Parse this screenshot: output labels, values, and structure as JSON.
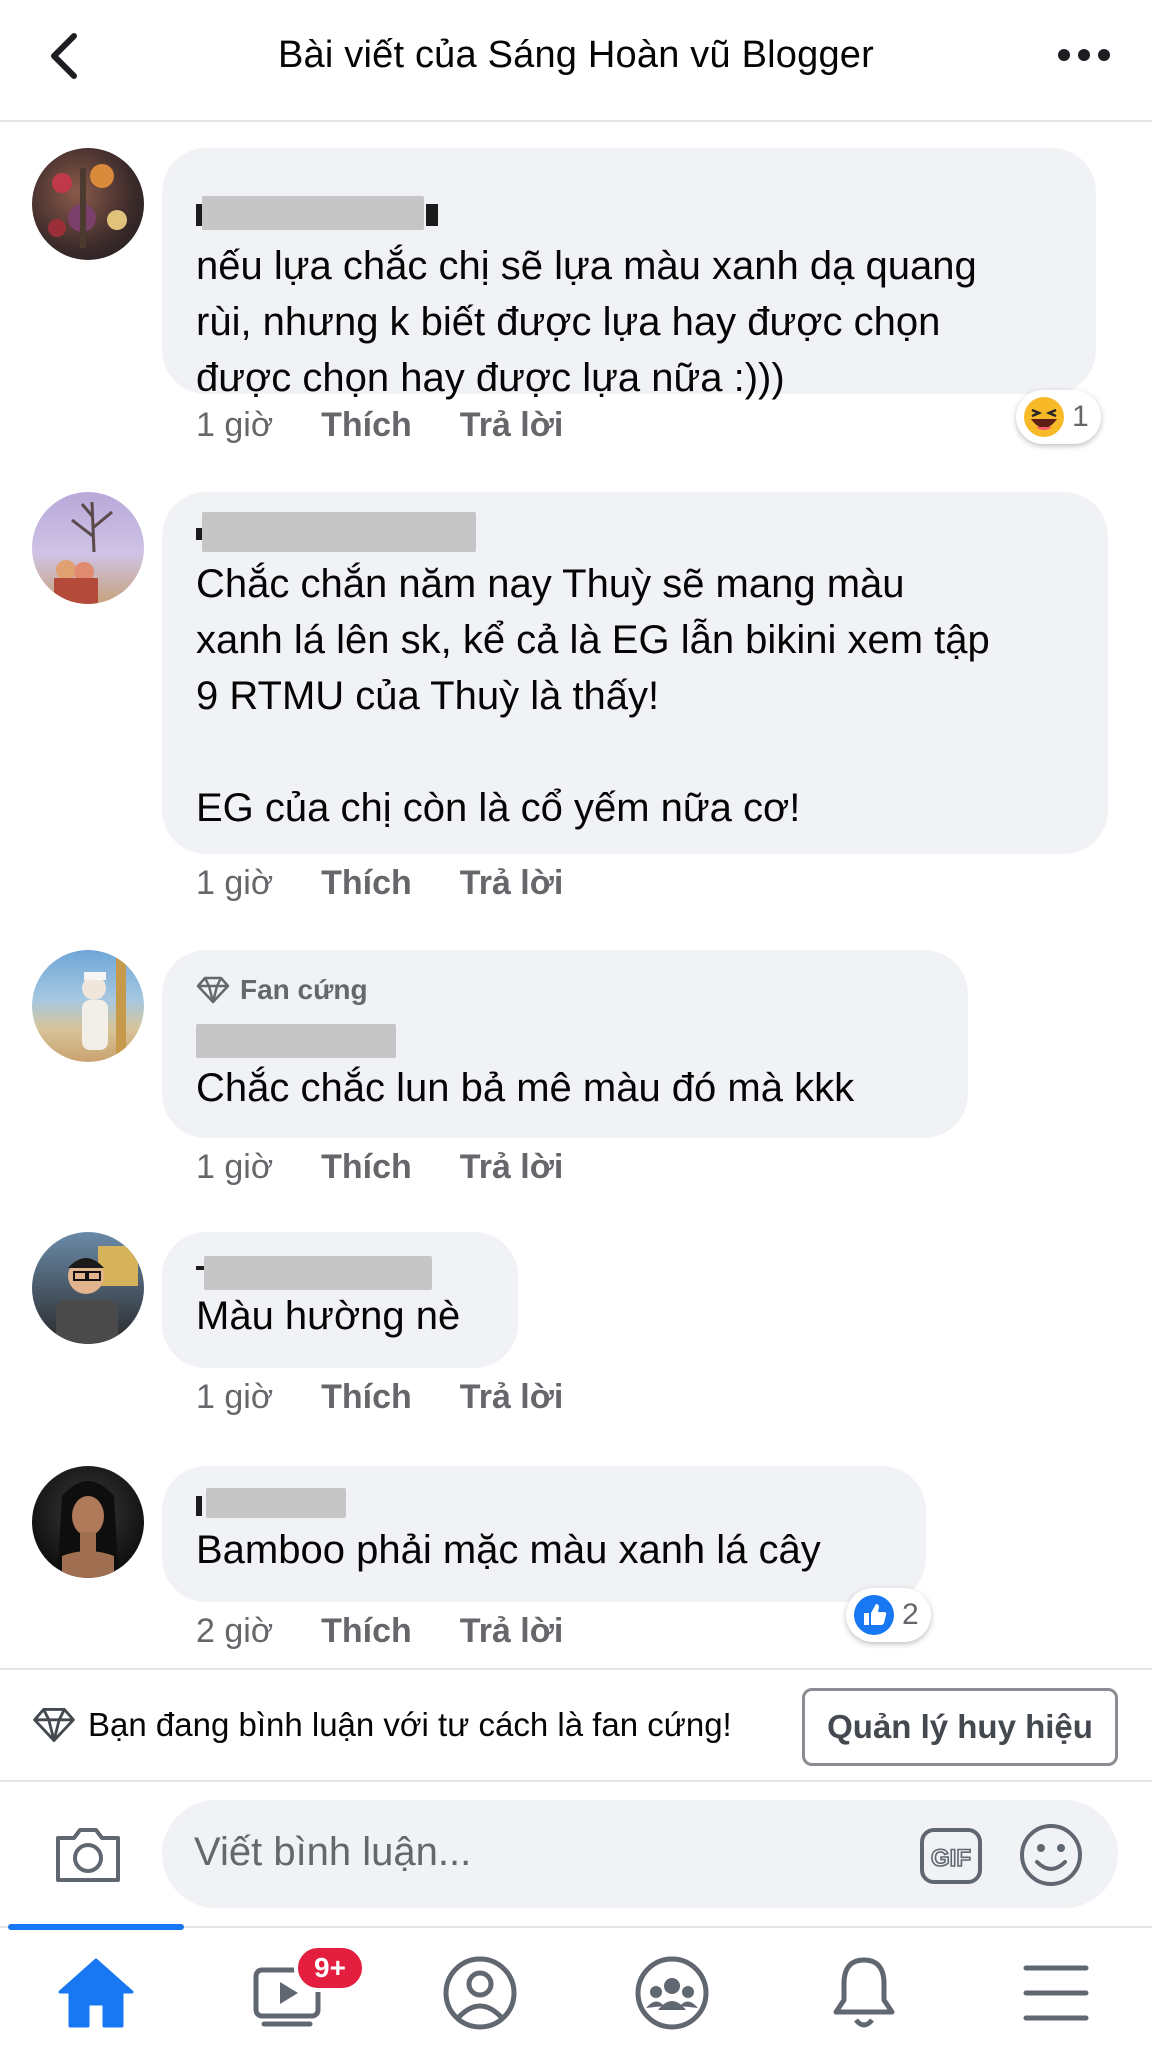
{
  "header": {
    "title": "Bài viết của Sáng Hoàn vũ Blogger",
    "back_icon": "chevron-left-icon",
    "more_icon": "more-horizontal-icon"
  },
  "comments": [
    {
      "badge": "",
      "text": "nếu lựa chắc chị sẽ lựa màu xanh dạ quang\nrùi, nhưng k biết được lựa hay được chọn\nđược chọn hay được lựa nữa :)))",
      "time": "1 giờ",
      "like": "Thích",
      "reply": "Trả lời",
      "reaction": {
        "icon": "haha-emoji-icon",
        "count": "1"
      }
    },
    {
      "badge": "",
      "text": "Chắc chắn năm nay Thuỳ sẽ mang màu\nxanh lá lên sk, kể cả là EG lẫn bikini xem tập\n9 RTMU của Thuỳ là thấy!\n\nEG của chị còn là cổ yếm nữa cơ!",
      "time": "1 giờ",
      "like": "Thích",
      "reply": "Trả lời"
    },
    {
      "badge": "Fan cứng",
      "text": "Chắc chắc lun bả mê màu đó mà kkk",
      "time": "1 giờ",
      "like": "Thích",
      "reply": "Trả lời"
    },
    {
      "badge": "",
      "text": "Màu hường nè",
      "time": "1 giờ",
      "like": "Thích",
      "reply": "Trả lời"
    },
    {
      "badge": "",
      "text": "Bamboo phải mặc màu xanh lá cây",
      "time": "2 giờ",
      "like": "Thích",
      "reply": "Trả lời",
      "reaction": {
        "icon": "like-thumb-icon",
        "count": "2"
      }
    }
  ],
  "fan_bar": {
    "text": "Bạn đang bình luận với tư cách là fan cứng!",
    "button": "Quản lý huy hiệu"
  },
  "composer": {
    "placeholder": "Viết bình luận...",
    "gif_label": "GIF"
  },
  "nav": {
    "items": [
      "home-icon",
      "watch-icon",
      "profile-icon",
      "groups-icon",
      "notifications-icon",
      "menu-icon"
    ],
    "watch_badge": "9+",
    "active": "home-icon"
  },
  "colors": {
    "accent": "#1877f2",
    "bubble": "#f0f2f5",
    "secondary_text": "#65676b",
    "badge_red": "#e41e3f"
  }
}
